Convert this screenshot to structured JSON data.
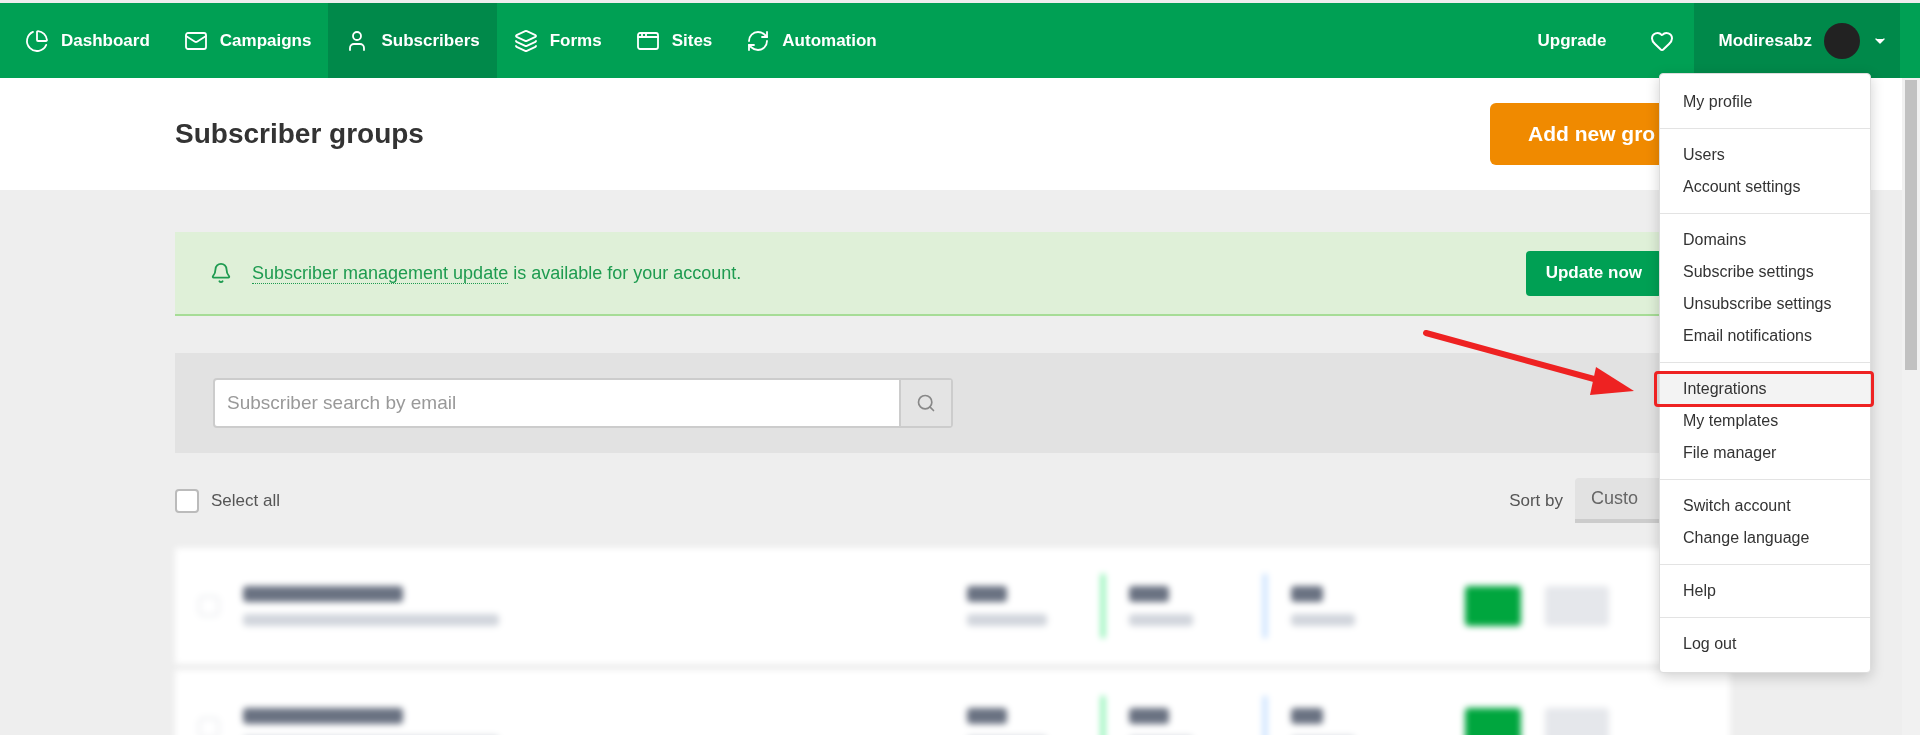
{
  "nav": {
    "items": [
      {
        "label": "Dashboard",
        "selected": false
      },
      {
        "label": "Campaigns",
        "selected": false
      },
      {
        "label": "Subscribers",
        "selected": true
      },
      {
        "label": "Forms",
        "selected": false
      },
      {
        "label": "Sites",
        "selected": false
      },
      {
        "label": "Automation",
        "selected": false
      }
    ],
    "upgrade": "Upgrade",
    "account": "Modiresabz"
  },
  "header": {
    "title": "Subscriber groups",
    "button": "Add new gro"
  },
  "banner": {
    "link": "Subscriber management update",
    "text": "is available for your account.",
    "button": "Update now"
  },
  "search": {
    "placeholder": "Subscriber search by email"
  },
  "select_all": {
    "label": "Select all",
    "checked": false
  },
  "sort": {
    "label": "Sort by",
    "value": "Custo"
  },
  "menu": [
    [
      {
        "label": "My profile",
        "selected": false
      }
    ],
    [
      {
        "label": "Users",
        "selected": false
      },
      {
        "label": "Account settings",
        "selected": false
      }
    ],
    [
      {
        "label": "Domains",
        "selected": false
      },
      {
        "label": "Subscribe settings",
        "selected": false
      },
      {
        "label": "Unsubscribe settings",
        "selected": false
      },
      {
        "label": "Email notifications",
        "selected": false
      }
    ],
    [
      {
        "label": "Integrations",
        "selected": true
      },
      {
        "label": "My templates",
        "selected": false
      },
      {
        "label": "File manager",
        "selected": false
      }
    ],
    [
      {
        "label": "Switch account",
        "selected": false
      },
      {
        "label": "Change language",
        "selected": false
      }
    ],
    [
      {
        "label": "Help",
        "selected": false
      }
    ],
    [
      {
        "label": "Log out",
        "selected": false
      }
    ]
  ]
}
